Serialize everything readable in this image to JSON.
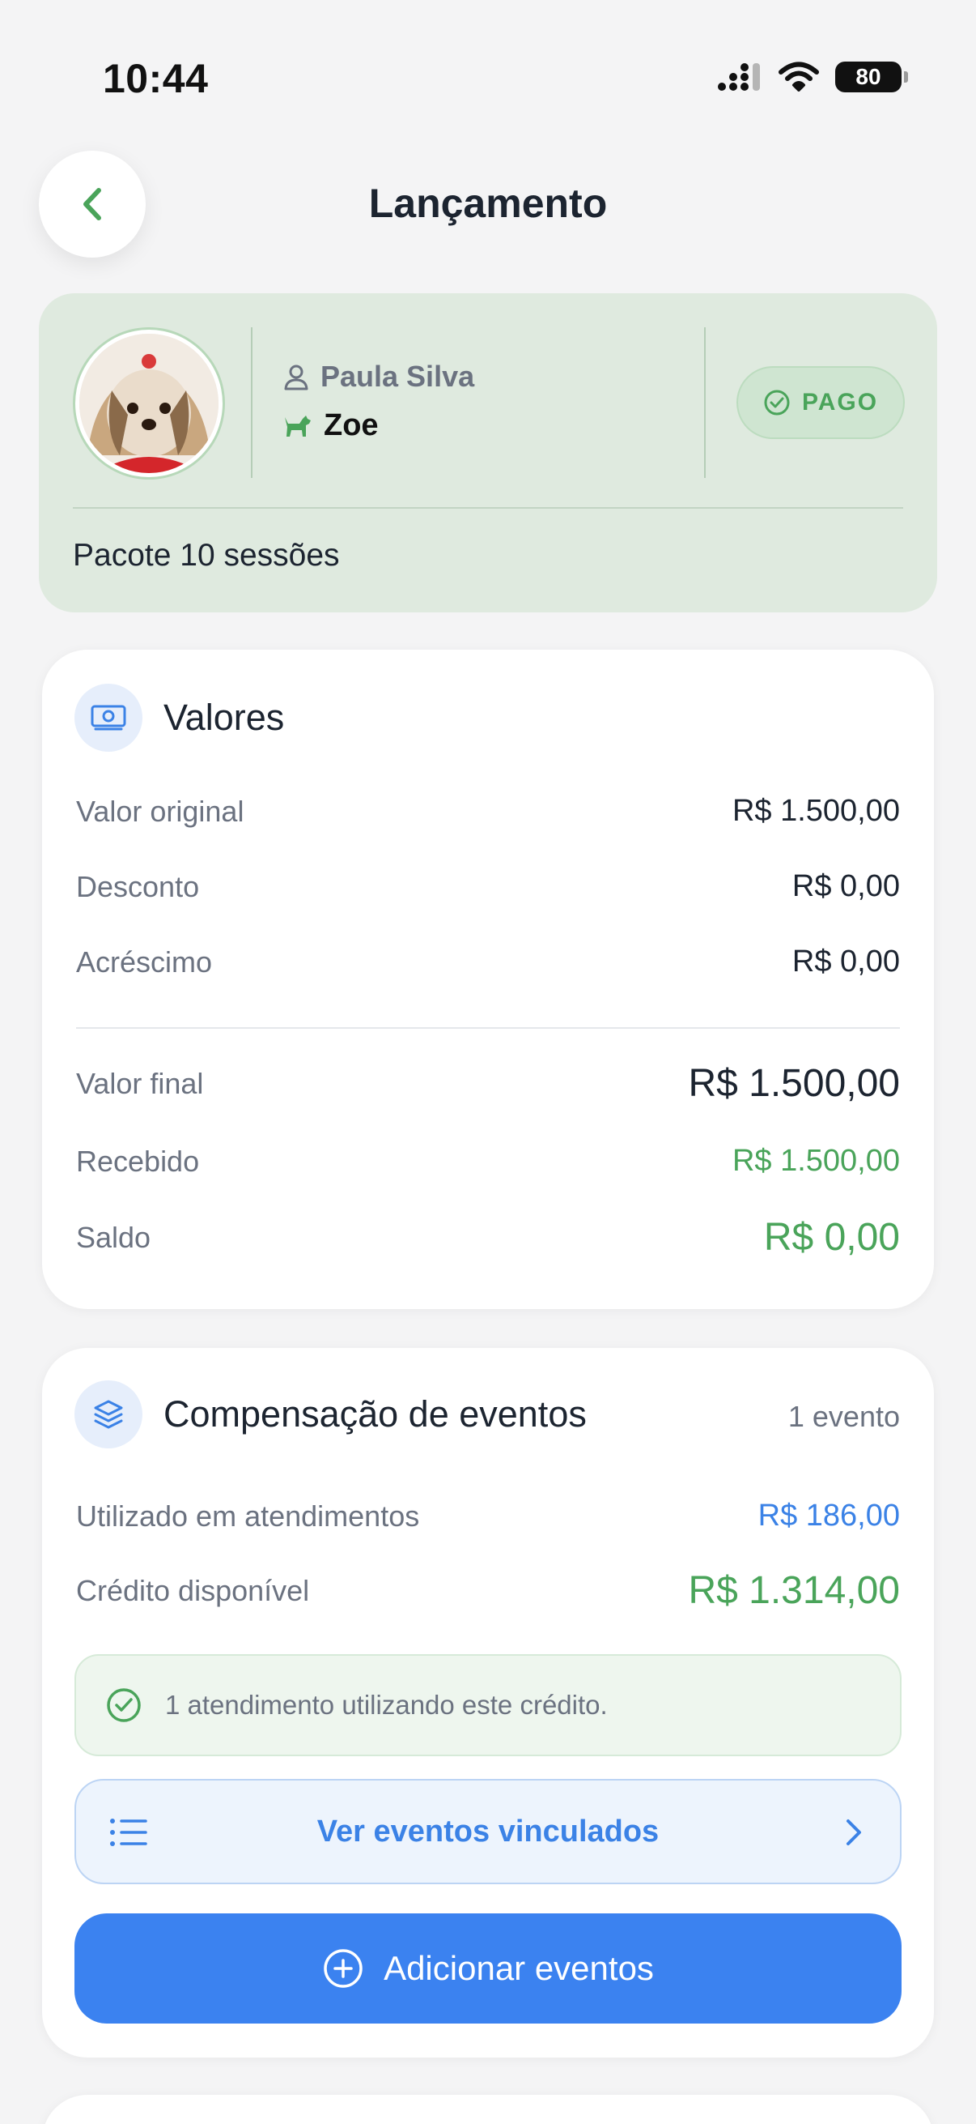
{
  "status_bar": {
    "time": "10:44",
    "battery": "80"
  },
  "header": {
    "title": "Lançamento"
  },
  "client": {
    "owner_name": "Paula Silva",
    "pet_name": "Zoe",
    "status": "PAGO",
    "package": "Pacote 10 sessões"
  },
  "values": {
    "title": "Valores",
    "original_label": "Valor original",
    "original_value": "R$ 1.500,00",
    "discount_label": "Desconto",
    "discount_value": "R$ 0,00",
    "surcharge_label": "Acréscimo",
    "surcharge_value": "R$ 0,00",
    "final_label": "Valor final",
    "final_value": "R$ 1.500,00",
    "received_label": "Recebido",
    "received_value": "R$ 1.500,00",
    "balance_label": "Saldo",
    "balance_value": "R$ 0,00"
  },
  "events": {
    "title": "Compensação de eventos",
    "count": "1 evento",
    "used_label": "Utilizado em atendimentos",
    "used_value": "R$ 186,00",
    "credit_label": "Crédito disponível",
    "credit_value": "R$ 1.314,00",
    "info": "1 atendimento utilizando este crédito.",
    "linked_button": "Ver eventos vinculados",
    "add_button": "Adicionar eventos"
  },
  "colors": {
    "accent_green": "#4aa45a",
    "accent_blue": "#3b82e6",
    "card_green_bg": "#dfeadf",
    "primary_button": "#3b82f0"
  },
  "icons": [
    "back-chevron-icon",
    "cell-signal-icon",
    "wifi-icon",
    "battery-icon",
    "user-icon",
    "dog-icon",
    "check-circle-icon",
    "money-icon",
    "layers-icon",
    "list-icon",
    "chevron-right-icon",
    "plus-circle-icon"
  ]
}
